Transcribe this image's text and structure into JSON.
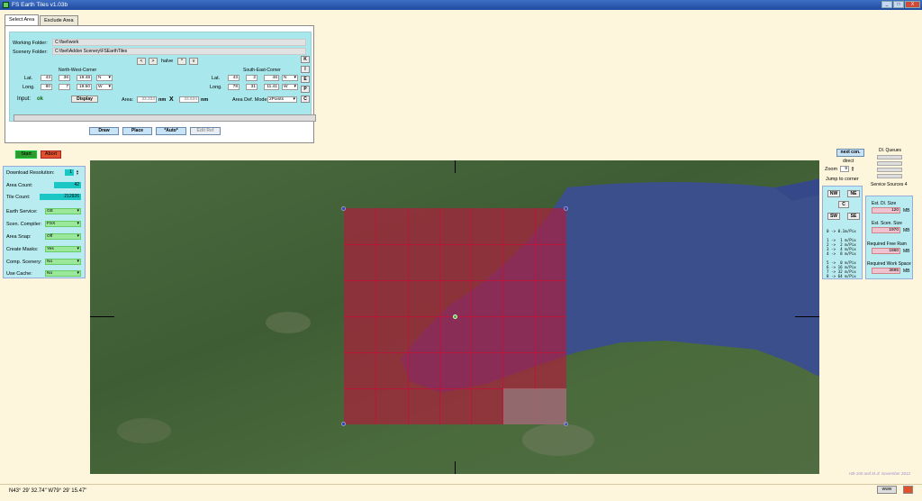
{
  "window": {
    "title": "FS Earth Tiles    v1.03b",
    "min": "_",
    "max": "□",
    "close": "X"
  },
  "tabs": [
    "Select Area",
    "Exclude Area"
  ],
  "select": {
    "working_folder_label": "Working Folder:",
    "working_folder": "C:\\fset\\work",
    "scenery_folder_label": "Scenery Folder:",
    "scenery_folder": "C:\\fset\\Addon Scenery\\FSEarthTiles",
    "prev": "<",
    "next": ">",
    "halve": "halve",
    "up": "^",
    "down": "v",
    "nw_title": "North-West-Corner",
    "se_title": "South-East-Corner",
    "lat": "Lat.",
    "long": "Long.",
    "nw_lat": [
      "43",
      "36",
      "19.48",
      "N"
    ],
    "nw_long": [
      "80",
      "7",
      "19.50",
      "W"
    ],
    "se_lat": [
      "43",
      "2",
      "46",
      "N"
    ],
    "se_long": [
      "78",
      "31",
      "11.41",
      "W"
    ],
    "input_label": "Input:",
    "input_status": "ok",
    "display_btn": "Display",
    "area_label": "Area:",
    "area_w": "33.333",
    "nm1": "nm",
    "x": "X",
    "area_h": "33.634",
    "nm2": "nm",
    "area_def_label": "Area Def. Mode:",
    "area_def_mode": "2Points",
    "side_buttons": [
      "K",
      "I",
      "E",
      "P",
      "C"
    ],
    "draw": "Draw",
    "place": "Place",
    "auto": "*Auto*",
    "edit_ref": "Edit Ref"
  },
  "controls": {
    "start": "Start",
    "abort": "Abort"
  },
  "settings": {
    "download_resolution_label": "Download Resolution:",
    "download_resolution": "1",
    "area_count_label": "Area Count:",
    "area_count": "42",
    "tile_count_label": "Tile Count:",
    "tile_count": "212926",
    "earth_service_label": "Earth Service:",
    "earth_service": "GE",
    "scen_compiler_label": "Scen. Compiler:",
    "scen_compiler": "FSX",
    "area_snap_label": "Area Snap:",
    "area_snap": "Off",
    "create_masks_label": "Create Masks:",
    "create_masks": "Yes",
    "comp_scenery_label": "Comp. Scenery:",
    "comp_scenery": "No",
    "use_cache_label": "Use Cache:",
    "use_cache": "No"
  },
  "right": {
    "next_con": "next con.",
    "direct": "direct",
    "zoom_label": "Zoom",
    "zoom": "9",
    "jump_label": "Jump to corner",
    "nw": "NW",
    "ne": "NE",
    "c": "C",
    "sw": "SW",
    "se": "SE",
    "res_table": "0 -> 0.1m/Pix\n\n1 ->  1 m/Pix\n2 ->  2 m/Pix\n3 ->  4 m/Pix\n4 ->  8 m/Pix\n\n5 ->  0 m/Pix\n6 -> 16 m/Pix\n7 -> 32 m/Pix\n8 -> 64 m/Pix",
    "dl_queues": "Dl. Queues",
    "service_sources": "Service Sources 4",
    "est_dl_size_label": "Est. Dl. Size",
    "est_dl_size": "120",
    "est_scen_size_label": "Est. Scen. Size",
    "est_scen_size": "1970",
    "req_free_ram_label": "Required Free Ram",
    "req_free_ram": "1860",
    "req_work_space_label": "Required Work Space",
    "req_work_space": "3695",
    "mb": "MB"
  },
  "status": {
    "coords": "N43° 29' 32.74\"     W79° 29' 15.47\"",
    "credits": "HB-100 and M.Jl. November 2012",
    "www": "www"
  },
  "colors": {
    "selection": "#b01e3c",
    "lake": "#3a4f8a",
    "land": "#4b6a3f"
  }
}
